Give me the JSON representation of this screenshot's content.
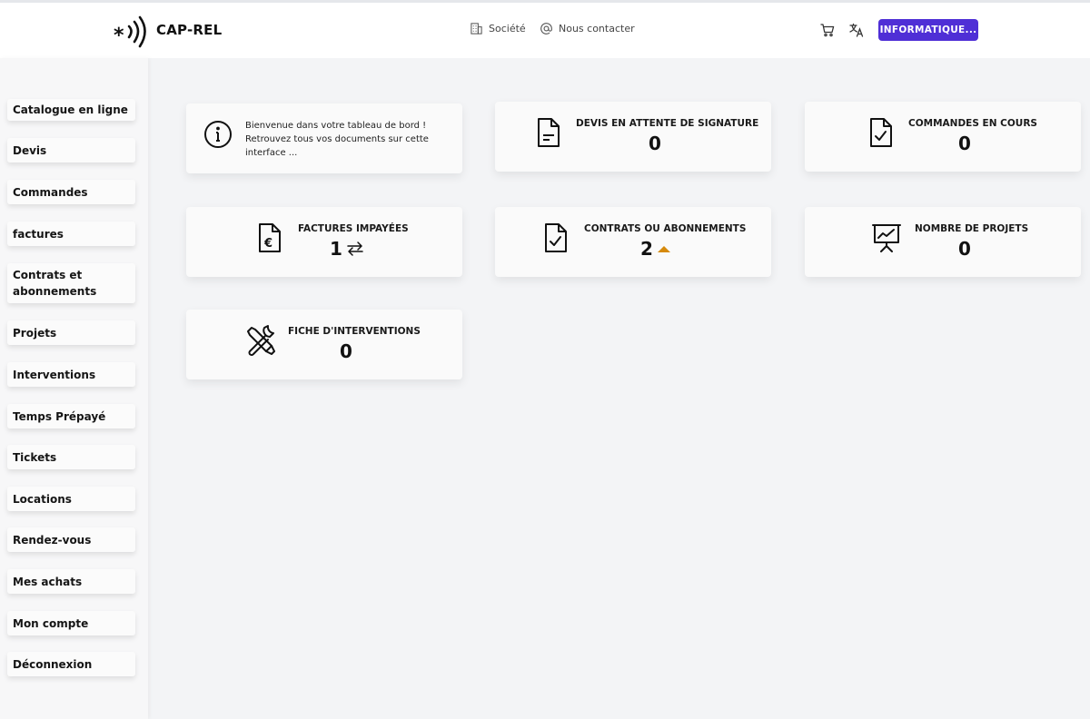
{
  "header": {
    "brand": "CAP-REL",
    "nav": [
      {
        "label": "Société",
        "icon": "building-icon"
      },
      {
        "label": "Nous contacter",
        "icon": "at-sign-icon"
      }
    ],
    "cart_icon": "cart-icon",
    "translate_icon": "translate-icon",
    "account_button": "INFORMATIQUE...",
    "accent_color": "#4f2fd6"
  },
  "sidebar": {
    "items": [
      {
        "label": "Catalogue en ligne"
      },
      {
        "label": "Devis"
      },
      {
        "label": "Commandes"
      },
      {
        "label": "factures"
      },
      {
        "label": "Contrats et abonnements"
      },
      {
        "label": "Projets"
      },
      {
        "label": "Interventions"
      },
      {
        "label": "Temps Prépayé"
      },
      {
        "label": "Tickets"
      },
      {
        "label": "Locations"
      },
      {
        "label": "Rendez-vous"
      },
      {
        "label": "Mes achats"
      },
      {
        "label": "Mon compte"
      },
      {
        "label": "Déconnexion"
      }
    ]
  },
  "dashboard": {
    "welcome": {
      "icon": "info-icon",
      "text": "Bienvenue dans votre tableau de bord ! Retrouvez tous vos documents sur cette interface ..."
    },
    "cards": [
      {
        "title": "DEVIS EN ATTENTE DE SIGNATURE",
        "value": "0",
        "icon": "document-icon"
      },
      {
        "title": "COMMANDES EN COURS",
        "value": "0",
        "icon": "document-check-icon"
      },
      {
        "title": "FACTURES IMPAYÉES",
        "value": "1",
        "icon": "invoice-euro-icon",
        "badge_icon": "swap-arrows-icon"
      },
      {
        "title": "CONTRATS OU ABONNEMENTS",
        "value": "2",
        "icon": "document-check-icon",
        "badge_icon": "caret-up-icon",
        "badge_color": "#d68a0c"
      },
      {
        "title": "NOMBRE DE PROJETS",
        "value": "0",
        "icon": "presentation-chart-icon"
      },
      {
        "title": "FICHE D'INTERVENTIONS",
        "value": "0",
        "icon": "tools-icon"
      }
    ]
  }
}
